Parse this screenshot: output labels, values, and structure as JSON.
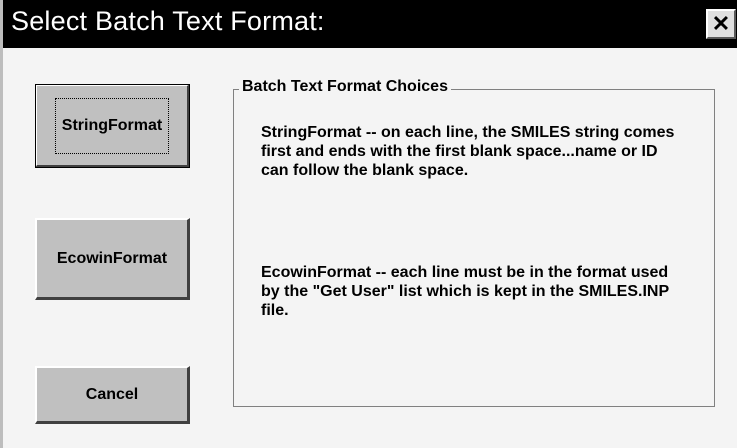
{
  "dialog": {
    "title": "Select Batch Text Format:",
    "close_symbol": "✕"
  },
  "buttons": {
    "string_format": "StringFormat",
    "ecowin_format": "EcowinFormat",
    "cancel": "Cancel"
  },
  "groupbox": {
    "legend": "Batch Text Format Choices",
    "string_description": "StringFormat -- on each line, the SMILES string comes first and ends with the first blank space...name or ID can follow the blank space.",
    "ecowin_description": "EcowinFormat --  each line must be in the format used by the \"Get User\" list which is kept in the SMILES.INP file."
  },
  "colors": {
    "titlebar": "#000000",
    "title_text": "#ffffff",
    "button_face": "#c0c0c0",
    "window_bg": "#f4f4f4"
  }
}
